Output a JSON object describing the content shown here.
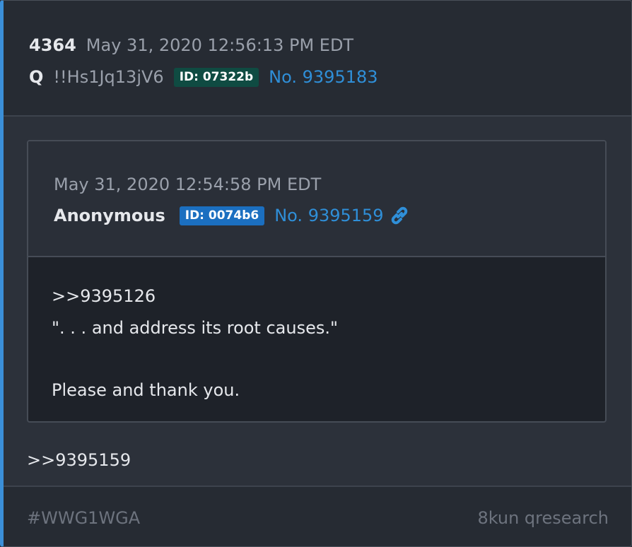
{
  "post": {
    "number": "4364",
    "timestamp": "May 31, 2020 12:56:13 PM EDT",
    "author": "Q",
    "tripcode": "!!Hs1Jq13jV6",
    "id_badge": "ID: 07322b",
    "post_no": "No. 9395183",
    "reply_ref": ">>9395159"
  },
  "quoted": {
    "timestamp": "May 31, 2020 12:54:58 PM EDT",
    "author": "Anonymous",
    "id_badge": "ID: 0074b6",
    "post_no": "No. 9395159",
    "link_icon": "link-icon",
    "lines": [
      ">>9395126",
      "\". . . and address its root causes.\"",
      "Please and thank you."
    ]
  },
  "footer": {
    "tag": "#WWG1WGA",
    "source": "8kun qresearch"
  },
  "colors": {
    "accent": "#3b8fd8",
    "link": "#2f8fd8",
    "id_badge_q": "#0f4b42",
    "id_badge_anon": "#1b6fc0"
  }
}
